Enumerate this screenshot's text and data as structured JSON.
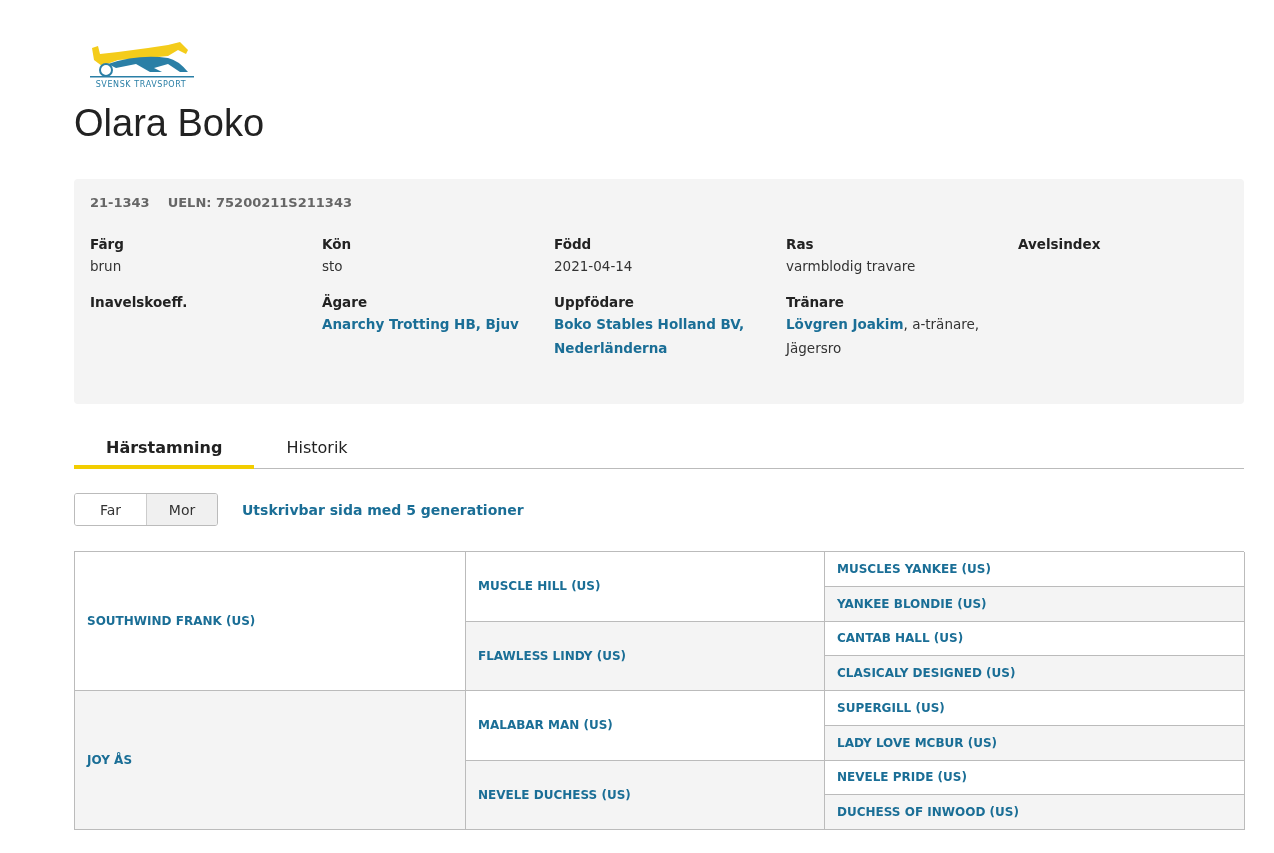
{
  "logo": {
    "text": "SVENSK TRAVSPORT"
  },
  "title": "Olara Boko",
  "info": {
    "ids": [
      "21-1343",
      "UELN: 75200211S211343"
    ],
    "fields": [
      {
        "label": "Färg",
        "value": "brun"
      },
      {
        "label": "Kön",
        "value": "sto"
      },
      {
        "label": "Född",
        "value": "2021-04-14"
      },
      {
        "label": "Ras",
        "value": "varmblodig travare"
      },
      {
        "label": "Avelsindex"
      },
      {
        "label": "Inavelskoeff."
      },
      {
        "label": "Ägare",
        "link": "Anarchy Trotting HB, Bjuv"
      },
      {
        "label": "Uppfödare",
        "link": "Boko Stables Holland BV, Nederländerna"
      },
      {
        "label": "Tränare",
        "link": "Lövgren Joakim",
        "value": ", a-tränare, Jägersro"
      }
    ]
  },
  "tabs": [
    {
      "label": "Härstamning",
      "selected": true
    },
    {
      "label": "Historik",
      "selected": false
    }
  ],
  "toggle": [
    {
      "label": "Far",
      "selected": false
    },
    {
      "label": "Mor",
      "selected": true
    }
  ],
  "print_link": "Utskrivbar sida med 5 generationer",
  "pedigree": [
    {
      "name": "SOUTHWIND FRANK (US)",
      "kind": "sire",
      "children": [
        {
          "name": "MUSCLE HILL (US)",
          "kind": "sire",
          "children": [
            {
              "name": "MUSCLES YANKEE (US)",
              "kind": "sire"
            },
            {
              "name": "YANKEE BLONDIE (US)",
              "kind": "dam"
            }
          ]
        },
        {
          "name": "FLAWLESS LINDY (US)",
          "kind": "dam",
          "children": [
            {
              "name": "CANTAB HALL (US)",
              "kind": "sire"
            },
            {
              "name": "CLASICALY DESIGNED (US)",
              "kind": "dam"
            }
          ]
        }
      ]
    },
    {
      "name": "JOY ÅS",
      "kind": "dam",
      "children": [
        {
          "name": "MALABAR MAN (US)",
          "kind": "sire",
          "children": [
            {
              "name": "SUPERGILL (US)",
              "kind": "sire"
            },
            {
              "name": "LADY LOVE MCBUR (US)",
              "kind": "dam"
            }
          ]
        },
        {
          "name": "NEVELE DUCHESS (US)",
          "kind": "dam",
          "children": [
            {
              "name": "NEVELE PRIDE (US)",
              "kind": "sire"
            },
            {
              "name": "DUCHESS OF INWOOD (US)",
              "kind": "dam"
            }
          ]
        }
      ]
    }
  ]
}
